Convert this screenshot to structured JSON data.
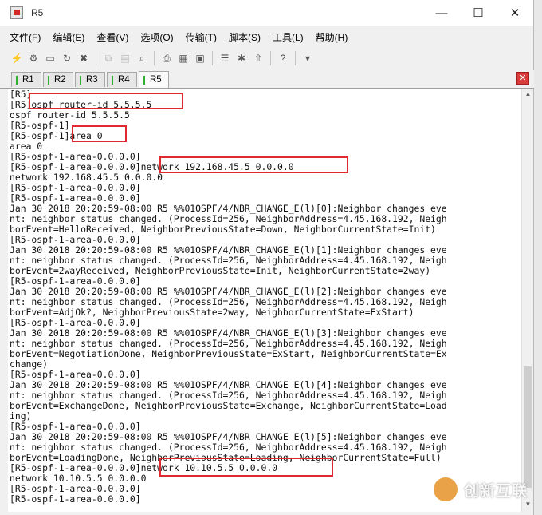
{
  "window": {
    "title": "R5",
    "controls": {
      "minimize": "—",
      "maximize": "☐",
      "close": "✕"
    }
  },
  "menu": [
    "文件(F)",
    "编辑(E)",
    "查看(V)",
    "选项(O)",
    "传输(T)",
    "脚本(S)",
    "工具(L)",
    "帮助(H)"
  ],
  "toolbar": {
    "icons": [
      "connect-icon",
      "quick-connect-icon",
      "connect-tab-icon",
      "reconnect-icon",
      "disconnect-icon",
      "copy-icon",
      "paste-icon",
      "find-icon",
      "print-icon",
      "print-setup-icon",
      "session-options-icon",
      "global-options-icon",
      "keymap-icon",
      "help-icon",
      "sftp-icon",
      "more-icon"
    ]
  },
  "tabs": [
    "R1",
    "R2",
    "R3",
    "R4",
    "R5"
  ],
  "active_tab": "R5",
  "terminal_lines": [
    "[R5]",
    "[R5]ospf router-id 5.5.5.5",
    "ospf router-id 5.5.5.5",
    "[R5-ospf-1]",
    "[R5-ospf-1]area 0",
    "area 0",
    "[R5-ospf-1-area-0.0.0.0]",
    "[R5-ospf-1-area-0.0.0.0]network 192.168.45.5 0.0.0.0",
    "network 192.168.45.5 0.0.0.0",
    "[R5-ospf-1-area-0.0.0.0]",
    "[R5-ospf-1-area-0.0.0.0]",
    "Jan 30 2018 20:20:59-08:00 R5 %%01OSPF/4/NBR_CHANGE_E(l)[0]:Neighbor changes eve",
    "nt: neighbor status changed. (ProcessId=256, NeighborAddress=4.45.168.192, Neigh",
    "borEvent=HelloReceived, NeighborPreviousState=Down, NeighborCurrentState=Init)",
    "[R5-ospf-1-area-0.0.0.0]",
    "Jan 30 2018 20:20:59-08:00 R5 %%01OSPF/4/NBR_CHANGE_E(l)[1]:Neighbor changes eve",
    "nt: neighbor status changed. (ProcessId=256, NeighborAddress=4.45.168.192, Neigh",
    "borEvent=2wayReceived, NeighborPreviousState=Init, NeighborCurrentState=2way)",
    "[R5-ospf-1-area-0.0.0.0]",
    "Jan 30 2018 20:20:59-08:00 R5 %%01OSPF/4/NBR_CHANGE_E(l)[2]:Neighbor changes eve",
    "nt: neighbor status changed. (ProcessId=256, NeighborAddress=4.45.168.192, Neigh",
    "borEvent=AdjOk?, NeighborPreviousState=2way, NeighborCurrentState=ExStart)",
    "[R5-ospf-1-area-0.0.0.0]",
    "Jan 30 2018 20:20:59-08:00 R5 %%01OSPF/4/NBR_CHANGE_E(l)[3]:Neighbor changes eve",
    "nt: neighbor status changed. (ProcessId=256, NeighborAddress=4.45.168.192, Neigh",
    "borEvent=NegotiationDone, NeighborPreviousState=ExStart, NeighborCurrentState=Ex",
    "change)",
    "[R5-ospf-1-area-0.0.0.0]",
    "Jan 30 2018 20:20:59-08:00 R5 %%01OSPF/4/NBR_CHANGE_E(l)[4]:Neighbor changes eve",
    "nt: neighbor status changed. (ProcessId=256, NeighborAddress=4.45.168.192, Neigh",
    "borEvent=ExchangeDone, NeighborPreviousState=Exchange, NeighborCurrentState=Load",
    "ing)",
    "[R5-ospf-1-area-0.0.0.0]",
    "Jan 30 2018 20:20:59-08:00 R5 %%01OSPF/4/NBR_CHANGE_E(l)[5]:Neighbor changes eve",
    "nt: neighbor status changed. (ProcessId=256, NeighborAddress=4.45.168.192, Neigh",
    "borEvent=LoadingDone, NeighborPreviousState=Loading, NeighborCurrentState=Full)",
    "[R5-ospf-1-area-0.0.0.0]network 10.10.5.5 0.0.0.0",
    "network 10.10.5.5 0.0.0.0",
    "[R5-ospf-1-area-0.0.0.0]",
    "[R5-ospf-1-area-0.0.0.0]"
  ],
  "watermark": {
    "text": "创新互联"
  },
  "colors": {
    "highlight_box": "#e0282f",
    "tab_indicator": "#2fb12f",
    "close_tab": "#d93a3a"
  }
}
